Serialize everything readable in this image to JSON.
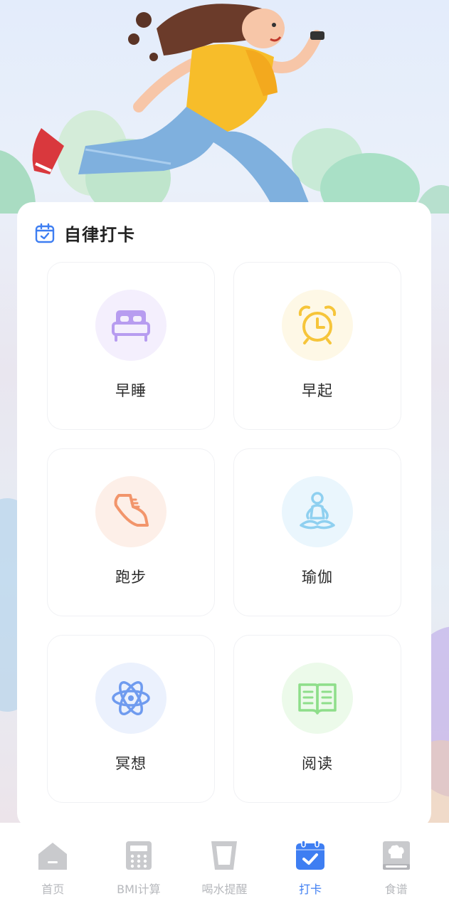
{
  "card": {
    "title": "自律打卡",
    "title_icon": "calendar-check-icon"
  },
  "habits": [
    {
      "label": "早睡",
      "icon": "bed-icon",
      "color": "#b79cf0",
      "bg": "#f4effd"
    },
    {
      "label": "早起",
      "icon": "alarm-clock-icon",
      "color": "#f6c53a",
      "bg": "#fef8e6"
    },
    {
      "label": "跑步",
      "icon": "sneaker-icon",
      "color": "#f2956b",
      "bg": "#fdefe8"
    },
    {
      "label": "瑜伽",
      "icon": "yoga-icon",
      "color": "#8fd0f0",
      "bg": "#eaf6fd"
    },
    {
      "label": "冥想",
      "icon": "atom-icon",
      "color": "#6f9bef",
      "bg": "#ebf1fd"
    },
    {
      "label": "阅读",
      "icon": "open-book-icon",
      "color": "#8ede8a",
      "bg": "#ecfaea"
    }
  ],
  "tabs": [
    {
      "label": "首页",
      "icon": "home-icon",
      "active": false
    },
    {
      "label": "BMI计算",
      "icon": "calculator-icon",
      "active": false
    },
    {
      "label": "喝水提醒",
      "icon": "cup-icon",
      "active": false
    },
    {
      "label": "打卡",
      "icon": "calendar-check-icon",
      "active": true
    },
    {
      "label": "食谱",
      "icon": "recipe-book-icon",
      "active": false
    }
  ],
  "colors": {
    "accent": "#3e7ef2",
    "tab_inactive": "#b7b9bd"
  }
}
